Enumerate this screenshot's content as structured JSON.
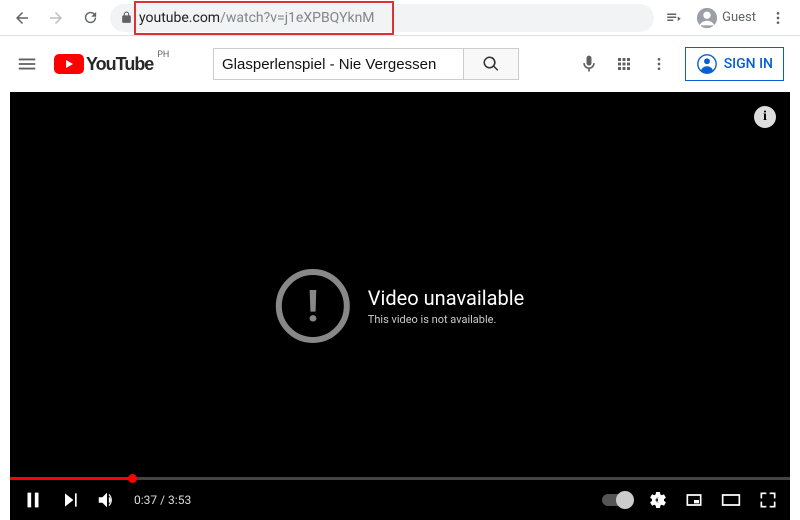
{
  "browser": {
    "url_domain": "youtube.com",
    "url_path": "/watch?v=j1eXPBQYknM",
    "guest_label": "Guest"
  },
  "masthead": {
    "logo_text": "YouTube",
    "country_code": "PH",
    "search_value": "Glasperlenspiel - Nie Vergessen",
    "signin_label": "SIGN IN"
  },
  "player": {
    "info_glyph": "i",
    "warn_glyph": "!",
    "unavailable_title": "Video unavailable",
    "unavailable_sub": "This video is not available.",
    "current_time": "0:37",
    "duration": "3:53",
    "time_sep": " / "
  }
}
